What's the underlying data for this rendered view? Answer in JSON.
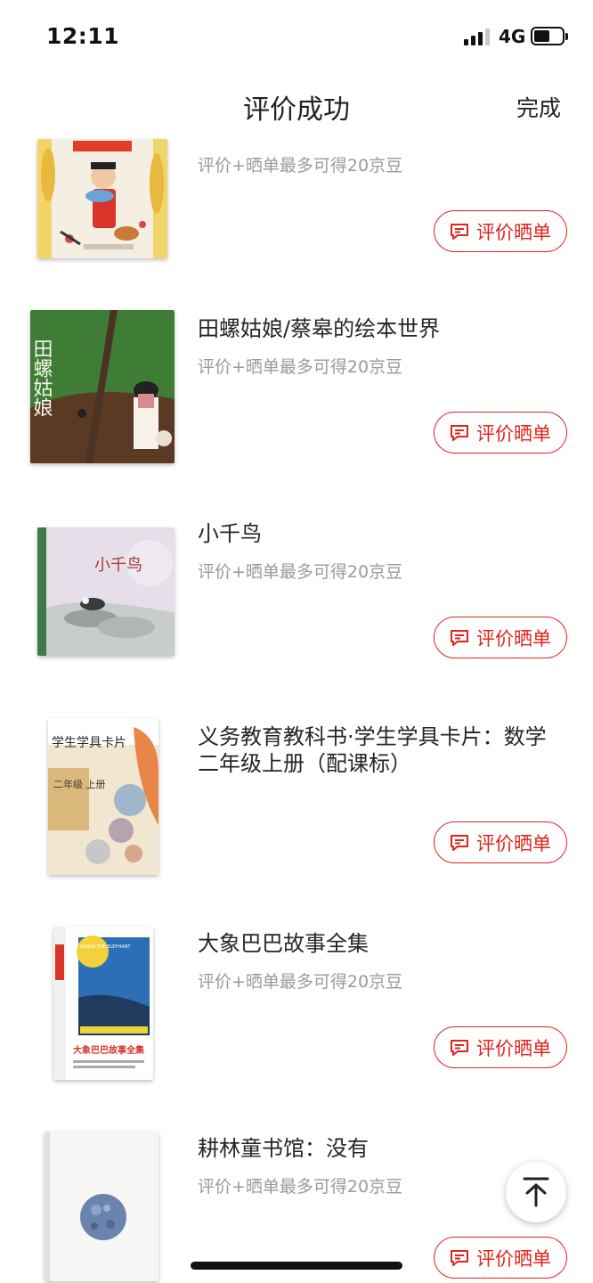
{
  "status_bar": {
    "time": "12:11",
    "network": "4G",
    "battery_level": 0.55
  },
  "nav": {
    "title": "评价成功",
    "done_label": "完成"
  },
  "items": [
    {
      "title": "",
      "hint": "评价+晒单最多可得20京豆",
      "button_label": "评价晒单",
      "cover_text": "糖人书"
    },
    {
      "title": "田螺姑娘/蔡皋的绘本世界",
      "hint": "评价+晒单最多可得20京豆",
      "button_label": "评价晒单",
      "cover_text": "田螺姑娘"
    },
    {
      "title": "小千鸟",
      "hint": "评价+晒单最多可得20京豆",
      "button_label": "评价晒单",
      "cover_text": "小千鸟"
    },
    {
      "title": "义务教育教科书·学生学具卡片：数学二年级上册（配课标）",
      "hint": "",
      "button_label": "评价晒单",
      "cover_text": "学生学具卡片",
      "cover_sub": "二年级 上册"
    },
    {
      "title": "大象巴巴故事全集",
      "hint": "评价+晒单最多可得20京豆",
      "button_label": "评价晒单",
      "cover_text": "大象巴巴故事全集",
      "cover_sub": "BABAR THE ELEPHANT"
    },
    {
      "title": "耕林童书馆：没有",
      "hint": "评价+晒单最多可得20京豆",
      "button_label": "评价晒单",
      "cover_text": ""
    }
  ],
  "icons": {
    "button_icon": "comment-icon",
    "fab_icon": "arrow-up-to-top-icon"
  },
  "colors": {
    "accent": "#e2231a",
    "hint": "#9a9a9a"
  }
}
